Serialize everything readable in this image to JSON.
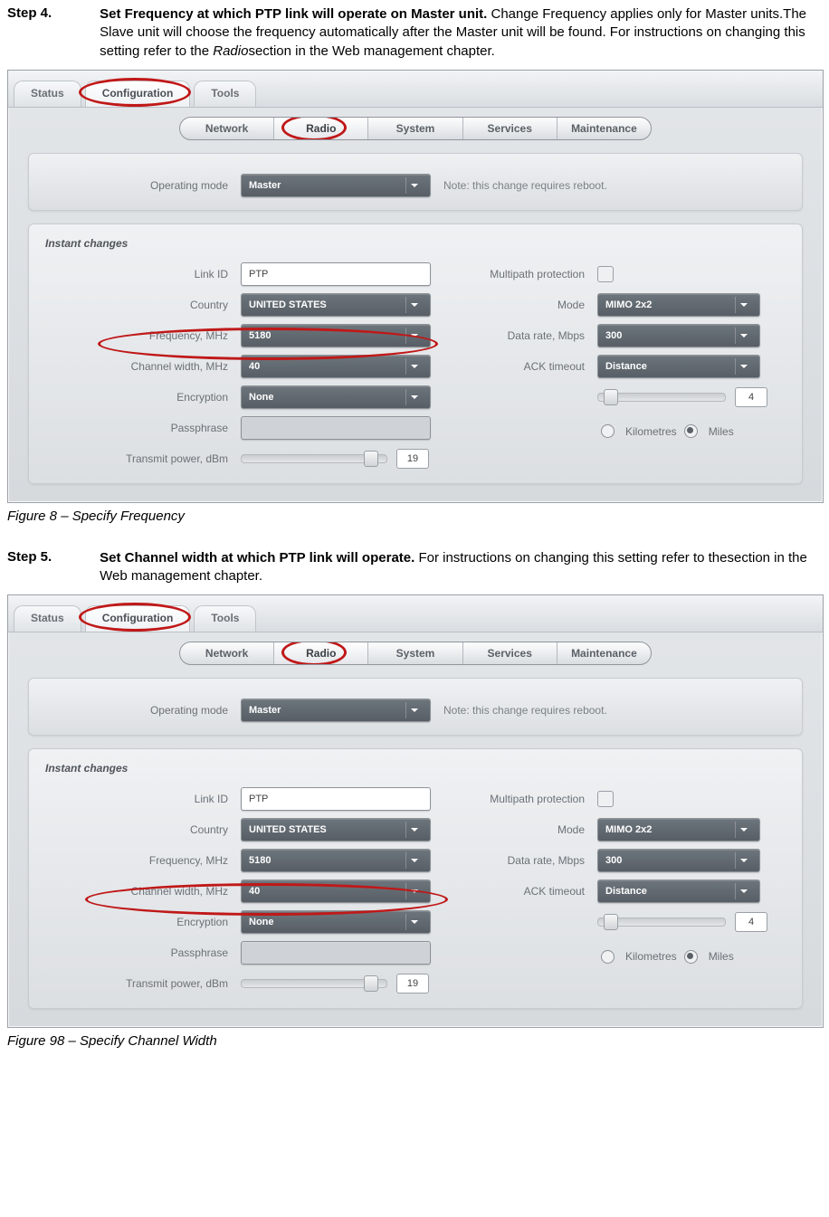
{
  "step4": {
    "label": "Step 4.",
    "title": "Set Frequency at which PTP link will operate on Master unit.",
    "body1": " Change Frequency applies only for Master units.The Slave unit will choose the frequency automatically after the Master unit will be found. For instructions on changing this setting refer to the ",
    "italic": "Radio",
    "body2": "section in the Web management chapter."
  },
  "figure1_caption": "Figure 8 – Specify Frequency",
  "step5": {
    "label": "Step 5.",
    "title": "Set Channel width at which PTP link will operate.",
    "body": " For instructions on changing this setting refer to thesection in the Web management chapter."
  },
  "figure2_caption": "Figure 98 – Specify Channel Width",
  "ui": {
    "tabs": {
      "status": "Status",
      "configuration": "Configuration",
      "tools": "Tools"
    },
    "subtabs": {
      "network": "Network",
      "radio": "Radio",
      "system": "System",
      "services": "Services",
      "maintenance": "Maintenance"
    },
    "operating_mode_label": "Operating mode",
    "operating_mode_value": "Master",
    "operating_mode_note": "Note: this change requires reboot.",
    "instant_changes": "Instant changes",
    "left": {
      "link_id_label": "Link ID",
      "link_id_value": "PTP",
      "country_label": "Country",
      "country_value": "UNITED STATES",
      "frequency_label": "Frequency, MHz",
      "frequency_value": "5180",
      "channel_width_label": "Channel width, MHz",
      "channel_width_value": "40",
      "encryption_label": "Encryption",
      "encryption_value": "None",
      "passphrase_label": "Passphrase",
      "tx_power_label": "Transmit power, dBm",
      "tx_power_value": "19"
    },
    "right": {
      "multipath_label": "Multipath protection",
      "mode_label": "Mode",
      "mode_value": "MIMO 2x2",
      "data_rate_label": "Data rate, Mbps",
      "data_rate_value": "300",
      "ack_label": "ACK timeout",
      "ack_value": "Distance",
      "distance_value": "4",
      "km": "Kilometres",
      "miles": "Miles"
    }
  }
}
